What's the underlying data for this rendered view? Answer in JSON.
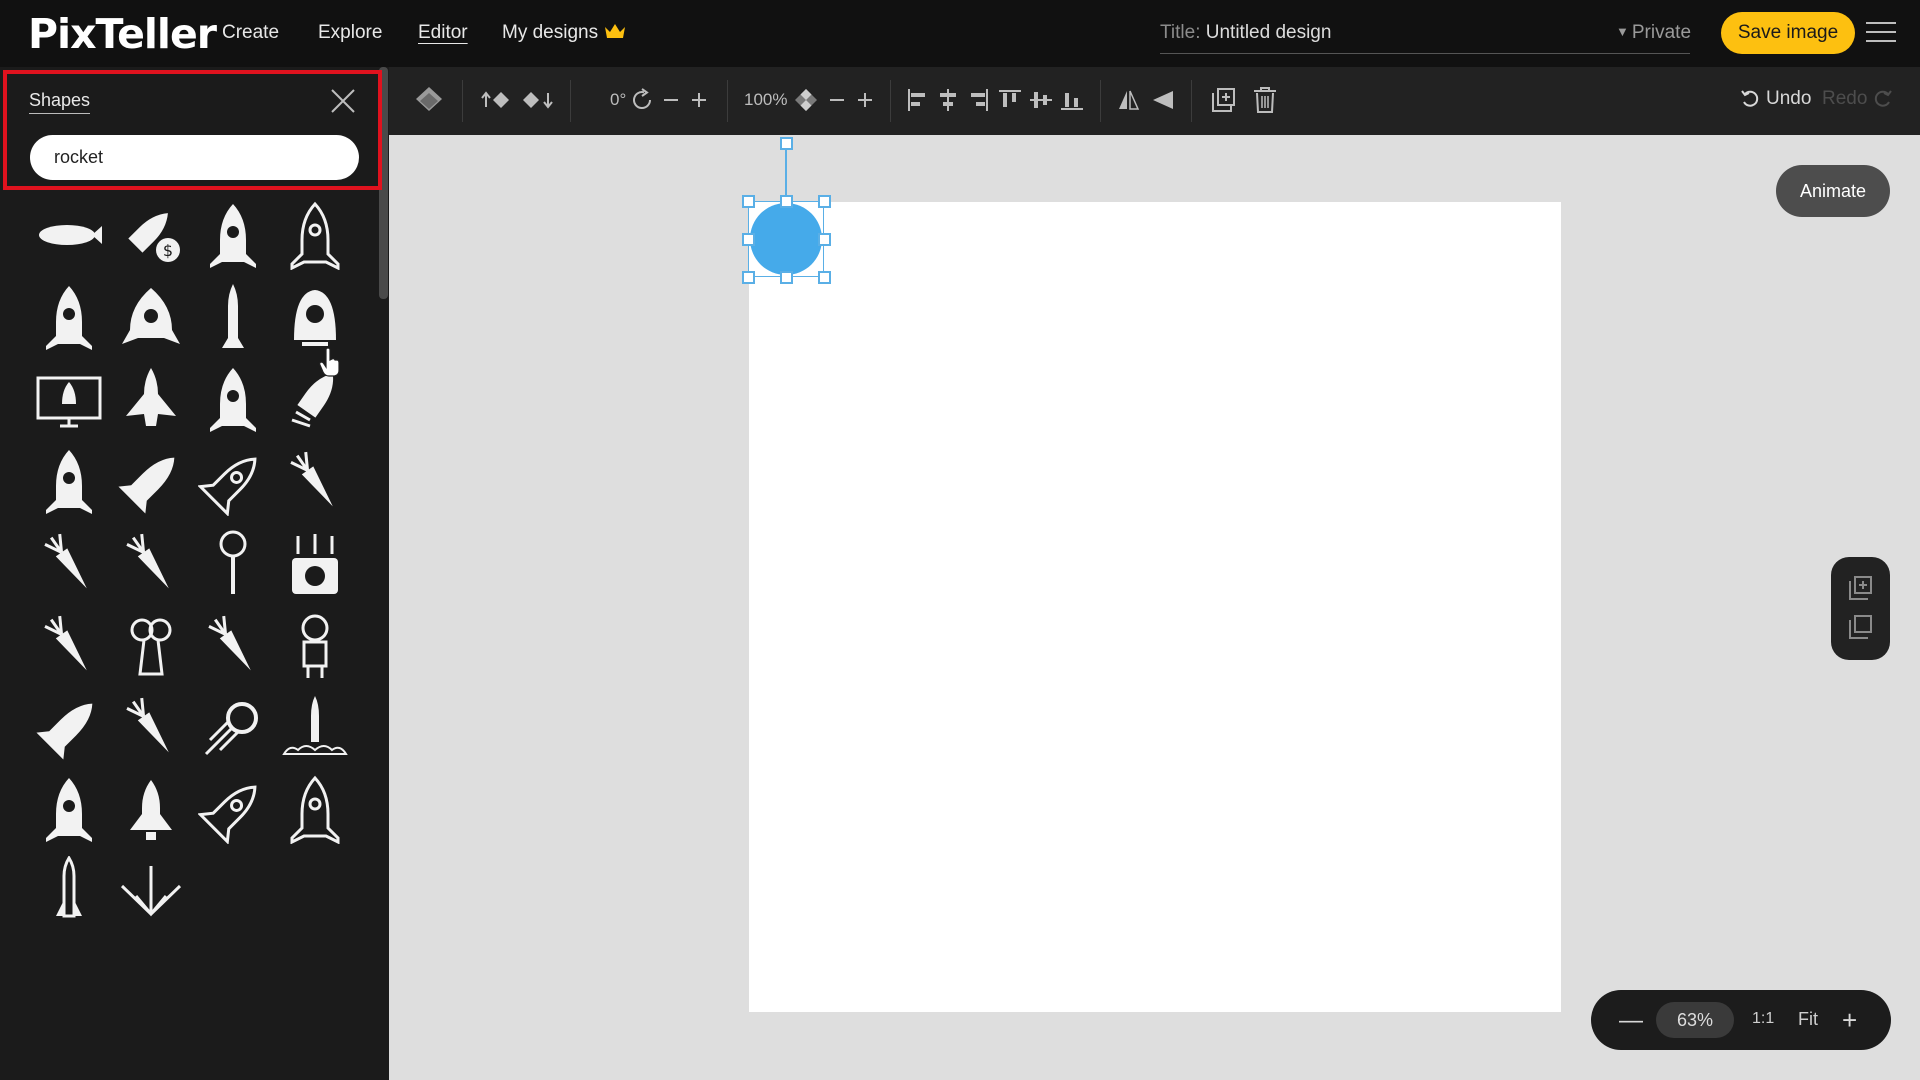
{
  "app": {
    "logo": "PixTeller",
    "nav": [
      {
        "label": "Create",
        "icon": ""
      },
      {
        "label": "Explore",
        "icon": ""
      },
      {
        "label": "Editor",
        "icon": ""
      },
      {
        "label": "My designs",
        "icon": "crown-icon"
      }
    ],
    "title_label": "Title:",
    "title_value": "Untitled design",
    "privacy": "Private",
    "save_label": "Save image",
    "menu_icon": "hamburger-icon"
  },
  "panel": {
    "title": "Shapes",
    "search_value": "rocket",
    "search_placeholder": "",
    "shapes": [
      "blimp-icon",
      "rocket-dollar-icon",
      "rocket-icon",
      "rocket-outline-icon",
      "rocket-icon",
      "rocket-round-icon",
      "missile-icon",
      "space-capsule-icon",
      "monitor-rocket-icon",
      "shuttle-icon",
      "rocket-window-icon",
      "rocket-launch-icon",
      "rocket-icon",
      "shuttle-diagonal-icon",
      "rocket-outline-diagonal-icon",
      "carrot-icon",
      "carrot-icon",
      "carrot-icon",
      "wrench-icon",
      "carrot-scale-icon",
      "carrot-icon",
      "broccoli-icon",
      "carrot-icon",
      "astronaut-icon",
      "rocket-diagonal-icon",
      "carrot-icon",
      "comet-icon",
      "rocket-launchpad-icon",
      "rocket-icon",
      "rocket-large-icon",
      "rocket-outline-diagonal-icon",
      "rocket-outline-icon",
      "rocket-slim-icon",
      "spaceship-icon"
    ]
  },
  "toolbar": {
    "rotation": "0°",
    "opacity": "100%",
    "undo": "Undo",
    "redo": "Redo"
  },
  "canvas": {
    "shape_color": "#45aaea",
    "animate_label": "Animate"
  },
  "zoom": {
    "level": "63%",
    "one_to_one": "1:1",
    "fit": "Fit"
  }
}
